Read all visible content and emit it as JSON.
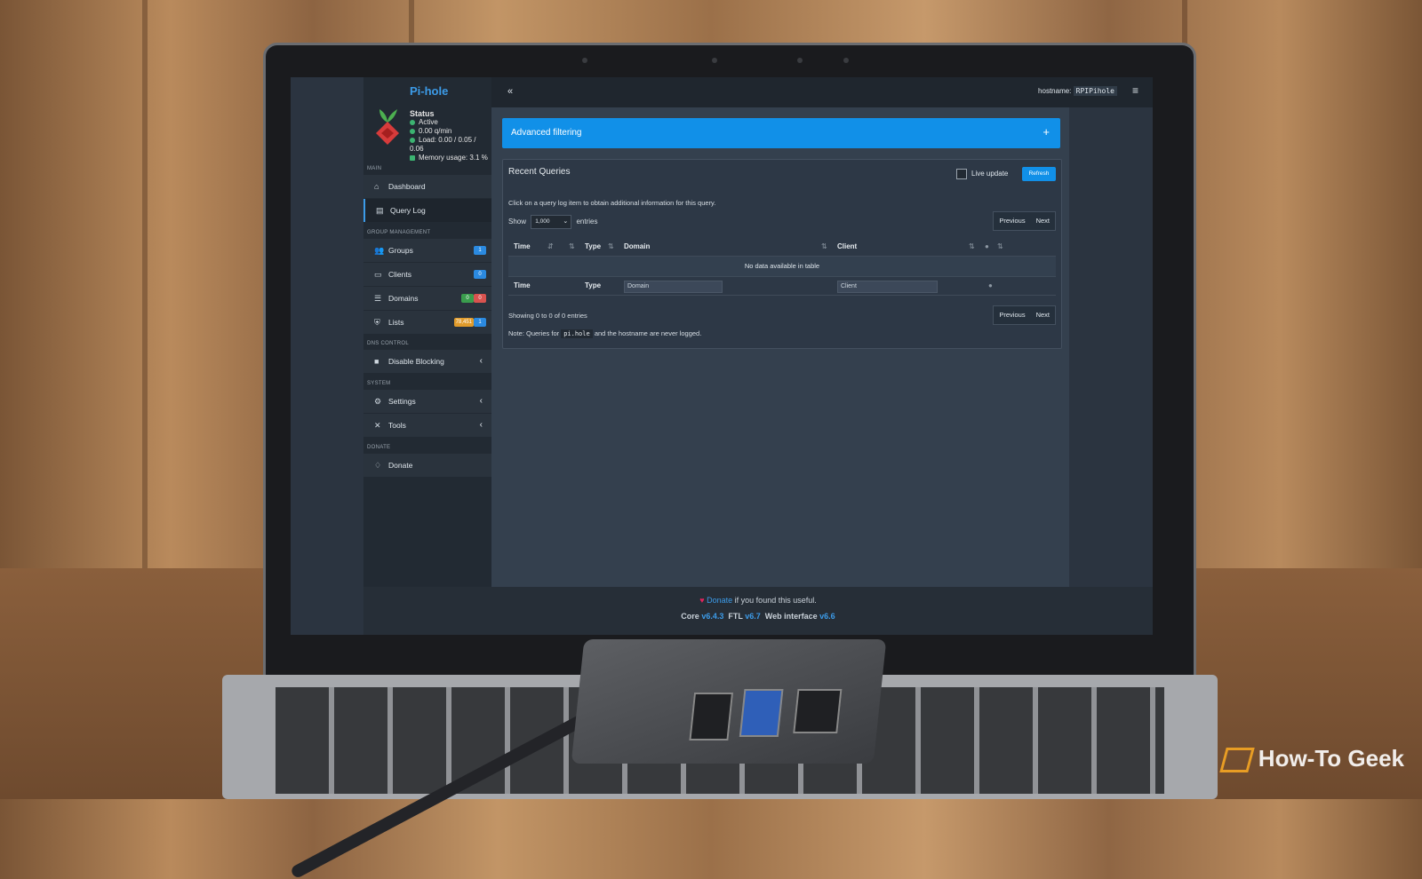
{
  "app": {
    "brand": "Pi-hole",
    "hostname_label": "hostname:",
    "hostname_value": "RPIPihole"
  },
  "status": {
    "title": "Status",
    "active": "Active",
    "rate": "0.00 q/min",
    "load": "Load: 0.00 / 0.05 / 0.06",
    "memory": "Memory usage: 3.1 %"
  },
  "sidebar": {
    "sections": {
      "main": "MAIN",
      "group": "GROUP MANAGEMENT",
      "dns": "DNS CONTROL",
      "system": "SYSTEM",
      "donate": "DONATE"
    },
    "items": {
      "dashboard": "Dashboard",
      "query_log": "Query Log",
      "groups": "Groups",
      "groups_badge": "1",
      "clients": "Clients",
      "clients_badge": "0",
      "domains": "Domains",
      "domains_badge_allow": "0",
      "domains_badge_deny": "0",
      "lists": "Lists",
      "lists_badge_count": "78,451",
      "lists_badge_lists": "1",
      "disable_blocking": "Disable Blocking",
      "settings": "Settings",
      "tools": "Tools",
      "donate": "Donate"
    }
  },
  "main": {
    "advanced_filtering": "Advanced filtering",
    "panel_title": "Recent Queries",
    "live_update": "Live update",
    "refresh": "Refresh",
    "hint": "Click on a query log item to obtain additional information for this query.",
    "show_label": "Show",
    "show_value": "1,000",
    "entries_label": "entries",
    "previous": "Previous",
    "next": "Next",
    "columns": {
      "time": "Time",
      "type": "Type",
      "domain": "Domain",
      "client": "Client"
    },
    "empty": "No data available in table",
    "filter_domain": "Domain",
    "filter_client": "Client",
    "showing": "Showing 0 to 0 of 0 entries",
    "note_prefix": "Note: Queries for",
    "note_code": "pi.hole",
    "note_suffix": "and the hostname are never logged."
  },
  "footer": {
    "donate": "Donate",
    "found_useful": "if you found this useful.",
    "core_label": "Core",
    "core_version": "v6.4.3",
    "ftl_label": "FTL",
    "ftl_version": "v6.7",
    "web_label": "Web interface",
    "web_version": "v6.6"
  },
  "watermark": "How-To Geek",
  "colors": {
    "accent": "#1190e8",
    "sidebar_bg": "#222a33",
    "content_bg": "#34404e"
  }
}
